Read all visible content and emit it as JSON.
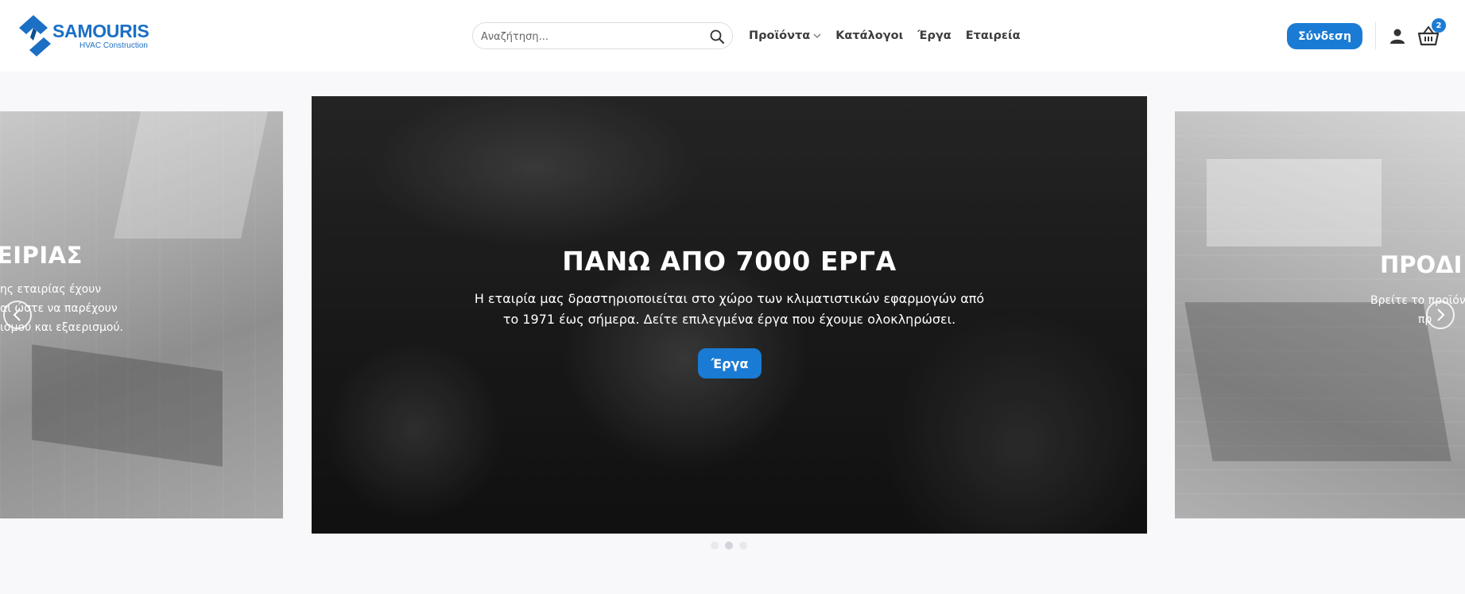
{
  "brand": {
    "name": "SAMOURIS",
    "tagline": "HVAC Construction",
    "color": "#1b6fc4"
  },
  "search": {
    "placeholder": "Αναζήτηση...",
    "value": "",
    "icon": "search-icon"
  },
  "nav": {
    "items": [
      {
        "label": "Προϊόντα",
        "has_dropdown": true
      },
      {
        "label": "Κατάλογοι"
      },
      {
        "label": "Έργα"
      },
      {
        "label": "Εταιρεία"
      }
    ]
  },
  "header_actions": {
    "login_label": "Σύνδεση",
    "account_icon": "user-icon",
    "cart_icon": "cart-icon",
    "cart_count": "2",
    "accent_color": "#1a7bd4"
  },
  "slider": {
    "prev_slide": {
      "title": "ΕΙΡΙΑΣ",
      "lines": [
        "ης εταιρίας έχουν",
        "αι ώστε να παρέχουν",
        "ισμού και εξαερισμού."
      ]
    },
    "current_slide": {
      "title": "ΠΑΝΩ ΑΠΟ 7000 ΕΡΓΑ",
      "text": "Η εταιρία μας δραστηριοποιείται στο χώρο των κλιματιστικών εφαρμογών από το 1971 έως σήμερα. Δείτε επιλεγμένα έργα που έχουμε ολοκληρώσει.",
      "button_label": "Έργα"
    },
    "next_slide": {
      "title": "ΠΡΟΔΙ",
      "lines": [
        "Βρείτε το προϊόν",
        "πρ"
      ]
    },
    "prev_arrow_icon": "chevron-left-icon",
    "next_arrow_icon": "chevron-right-icon",
    "dots": 3,
    "active_dot": 2
  }
}
